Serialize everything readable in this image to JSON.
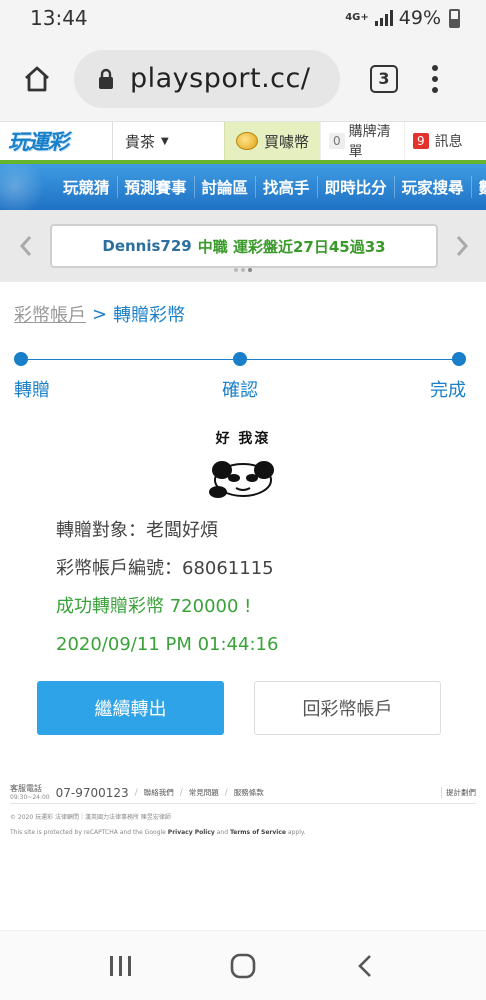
{
  "status_bar": {
    "time": "13:44",
    "network": "4G+",
    "battery": "49%"
  },
  "browser": {
    "url": "playsport.cc/",
    "tab_count": "3"
  },
  "site_header": {
    "logo": "玩運彩",
    "user": "貴茶",
    "buy_coins": "買噱幣",
    "cart_count": "0",
    "cart_label": "購牌清單",
    "msg_count": "9",
    "msg_label": "訊息"
  },
  "nav": {
    "items": [
      "玩競猜",
      "預測賽事",
      "討論區",
      "找高手",
      "即時比分",
      "玩家搜尋",
      "數據"
    ]
  },
  "ticker": {
    "user": "Dennis729",
    "message": "中職 運彩盤近27日45過33"
  },
  "breadcrumb": {
    "parent": "彩幣帳戶",
    "separator": ">",
    "current": "轉贈彩幣"
  },
  "steps": {
    "step1": "轉贈",
    "step2": "確認",
    "step3": "完成"
  },
  "sticker": {
    "caption": "好 我滾"
  },
  "result": {
    "recipient": "轉贈對象：老闆好煩",
    "account": "彩幣帳戶編號：68061115",
    "success": "成功轉贈彩幣 720000 !",
    "datetime": "2020/09/11 PM 01:44:16"
  },
  "buttons": {
    "continue": "繼續轉出",
    "back": "回彩幣帳戶"
  },
  "footer": {
    "service_label": "客服電話",
    "service_hours": "09:30~24:00",
    "phone": "07-9700123",
    "links": [
      "聯絡我們",
      "常見問題",
      "服務條款"
    ],
    "right_link": "提計劃們",
    "copyright": "© 2020 玩運彩 法律顧問｜漢英國力法律事務所 陳昱宏律師",
    "recaptcha_prefix": "This site is protected by reCAPTCHA and the Google",
    "privacy": "Privacy Policy",
    "and": "and",
    "terms": "Terms of Service",
    "apply": "apply."
  }
}
